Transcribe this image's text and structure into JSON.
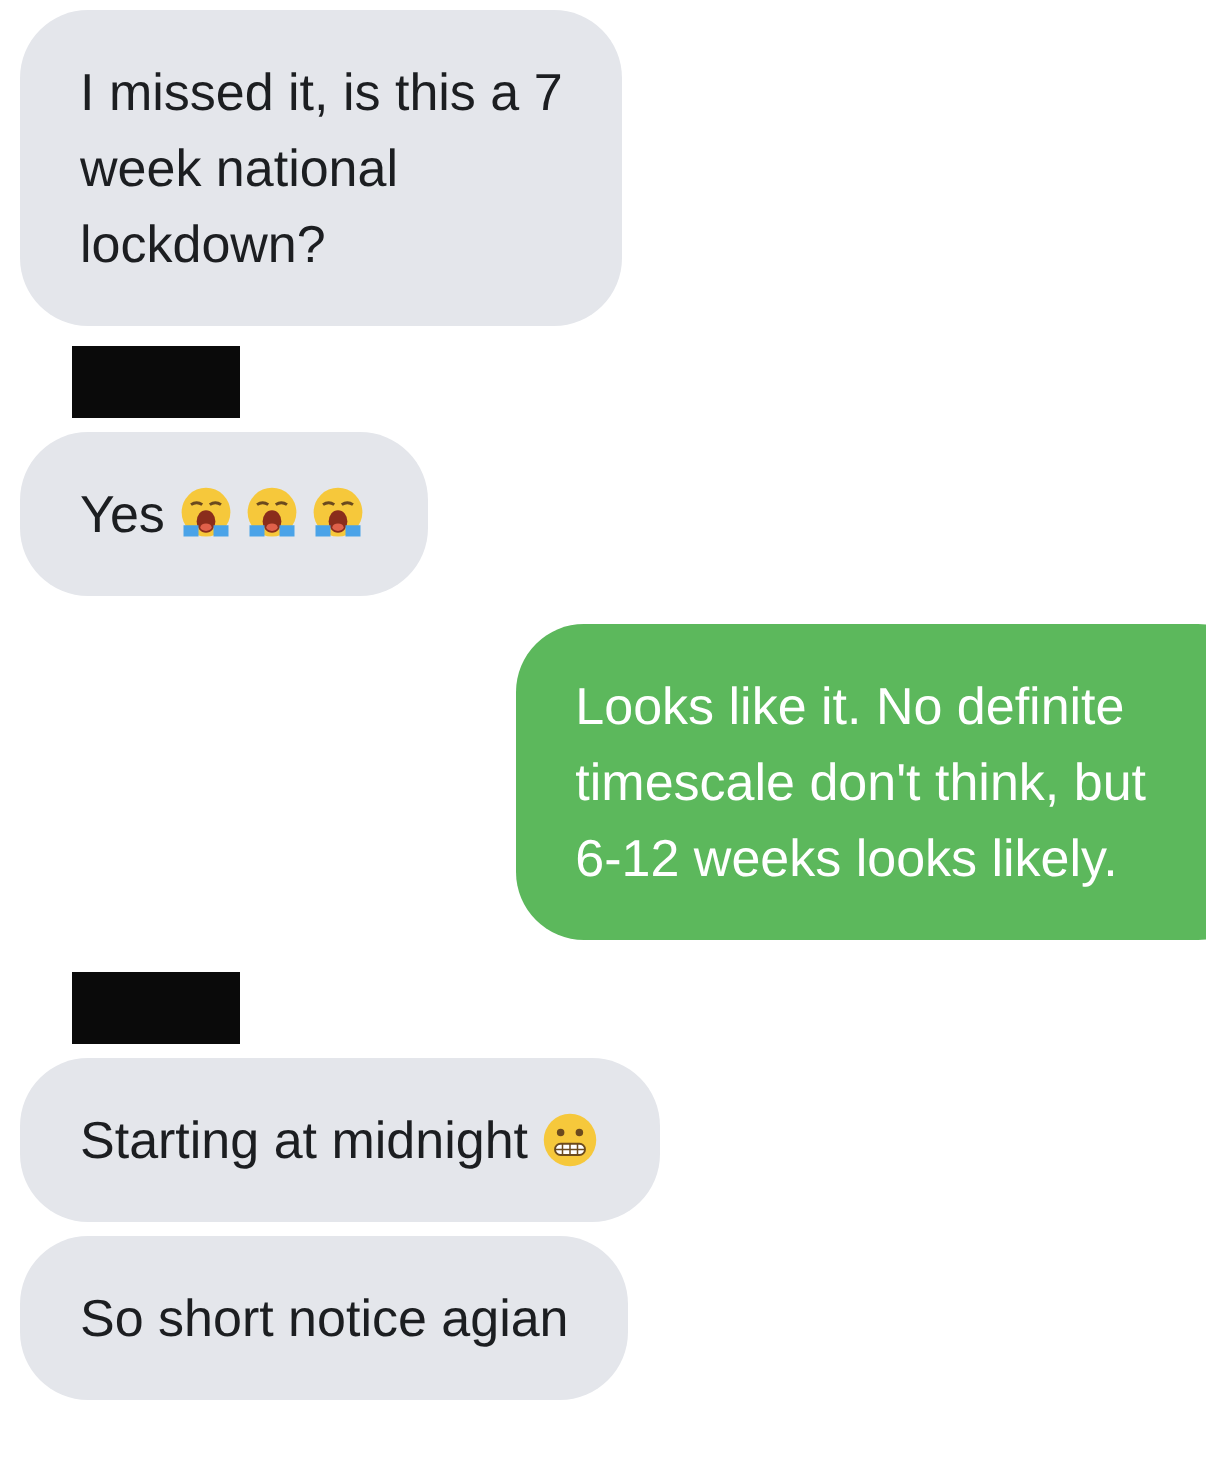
{
  "groups": [
    {
      "kind": "incoming",
      "sender_redacted": false,
      "messages": [
        {
          "text": "I missed it, is this a 7\nweek national\nlockdown?"
        }
      ]
    },
    {
      "kind": "incoming",
      "sender_redacted": true,
      "messages": [
        {
          "text": "Yes",
          "emojis": [
            {
              "kind": "crying"
            },
            {
              "kind": "crying"
            },
            {
              "kind": "crying"
            }
          ]
        }
      ]
    },
    {
      "kind": "outgoing",
      "sender_redacted": false,
      "messages": [
        {
          "text": "Looks like it. No definite\ntimescale don't think, but\n6-12 weeks looks likely."
        }
      ]
    },
    {
      "kind": "incoming",
      "sender_redacted": true,
      "messages": [
        {
          "text": "Starting at midnight",
          "emojis": [
            {
              "kind": "grimacing"
            }
          ]
        },
        {
          "text": "So short notice agian"
        }
      ]
    }
  ]
}
